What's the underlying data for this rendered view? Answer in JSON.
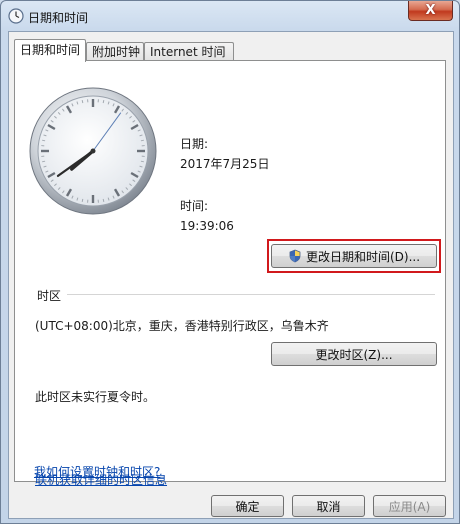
{
  "window": {
    "title": "日期和时间",
    "close_symbol": "X"
  },
  "tabs": [
    {
      "label": "日期和时间",
      "active": true
    },
    {
      "label": "附加时钟",
      "active": false
    },
    {
      "label": "Internet 时间",
      "active": false
    }
  ],
  "clock": {
    "time": "19:39:06"
  },
  "date": {
    "label": "日期:",
    "value": "2017年7月25日"
  },
  "time": {
    "label": "时间:",
    "value": "19:39:06"
  },
  "change_datetime_button": "更改日期和时间(D)...",
  "timezone": {
    "group_label": "时区",
    "value": "(UTC+08:00)北京，重庆，香港特别行政区，乌鲁木齐",
    "change_button": "更改时区(Z)..."
  },
  "dst_note": "此时区未实行夏令时。",
  "links": {
    "timezone_info": "联机获取详细的时区信息",
    "how_to_set": "我如何设置时钟和时区?"
  },
  "footer": {
    "ok": "确定",
    "cancel": "取消",
    "apply": "应用(A)"
  }
}
